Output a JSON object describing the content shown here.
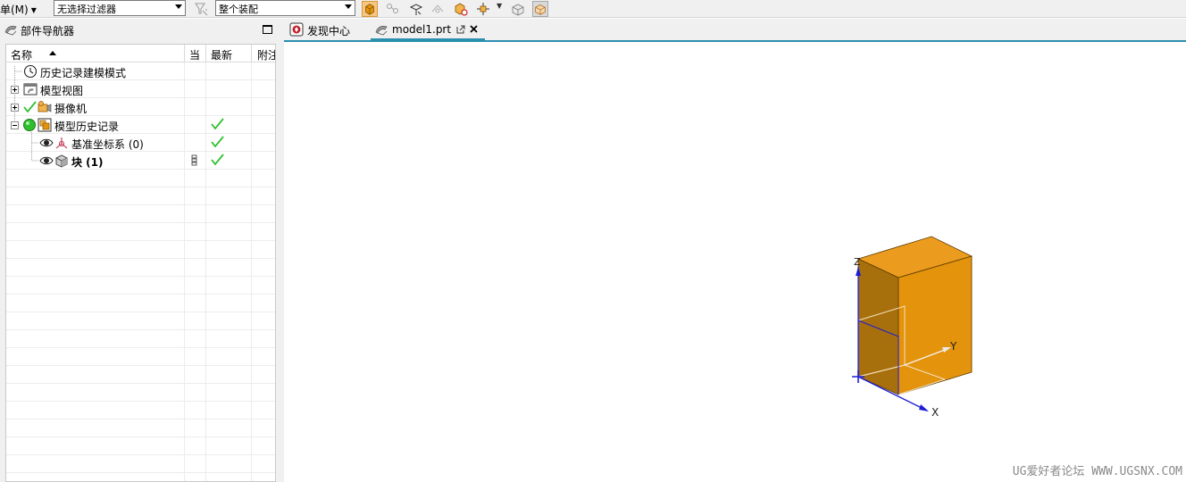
{
  "toolbar": {
    "menu_label": "单(M)",
    "filter_value": "无选择过滤器",
    "scope_value": "整个装配"
  },
  "navigator": {
    "title": "部件导航器",
    "columns": [
      "名称",
      "当",
      "最新",
      "附注"
    ],
    "rows": [
      {
        "label": "历史记录建模模式",
        "icon": "clock-icon",
        "latest": false
      },
      {
        "label": "模型视图",
        "icon": "model-views-icon",
        "latest": false
      },
      {
        "label": "摄像机",
        "icon": "camera-icon",
        "latest": false
      },
      {
        "label": "模型历史记录",
        "icon": "model-history-icon",
        "latest": true
      },
      {
        "label": "基准坐标系 (0)",
        "icon": "datum-csys-icon",
        "latest": true
      },
      {
        "label": "块 (1)",
        "icon": "block-icon",
        "latest": true
      }
    ]
  },
  "tabs": [
    {
      "label": "发现中心",
      "icon": "discovery-icon"
    },
    {
      "label": "model1.prt",
      "icon": "part-icon",
      "active": true
    }
  ],
  "viewport": {
    "axis_labels": {
      "x": "X",
      "y": "Y",
      "z": "Z"
    },
    "body_color": "#e3930c",
    "watermark": "UG爱好者论坛 WWW.UGSNX.COM"
  },
  "colors": {
    "accent": "#2b8fae",
    "check": "#2fbf2f",
    "axis": "#1c1cd6"
  }
}
